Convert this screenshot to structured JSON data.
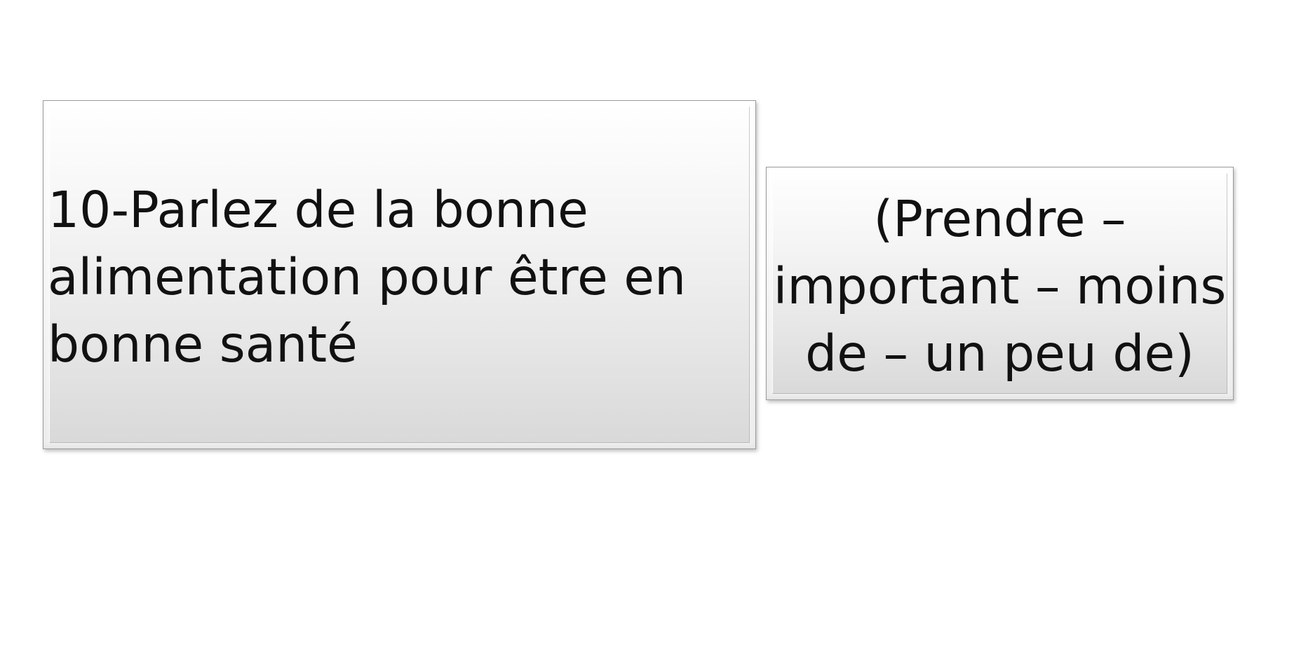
{
  "question_box": {
    "lines": [
      "10-Parlez de la bonne",
      "alimentation pour être en",
      "bonne santé"
    ]
  },
  "hint_box": {
    "lines": [
      "(Prendre –",
      "important – moins",
      "de – un peu de)"
    ]
  }
}
